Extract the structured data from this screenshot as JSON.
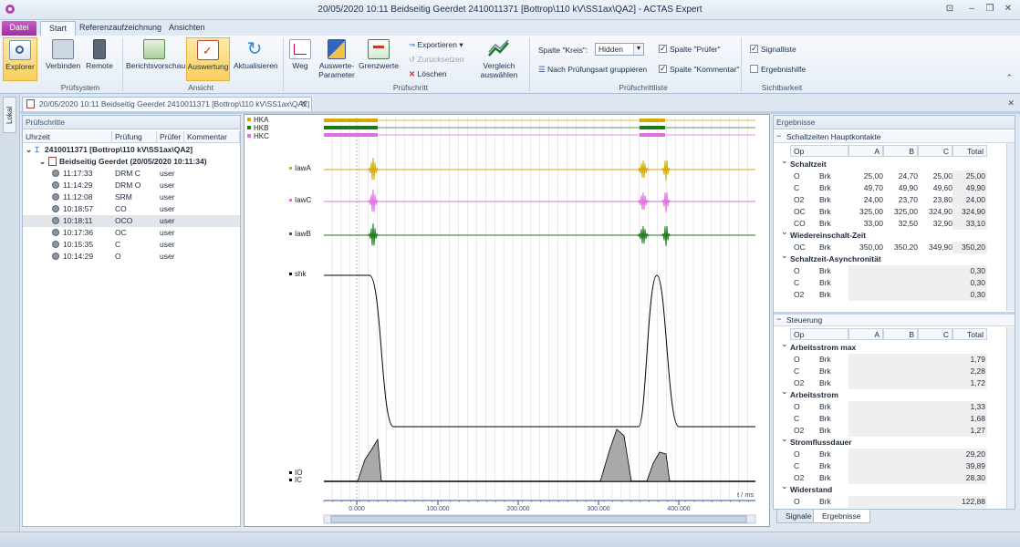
{
  "window": {
    "title": "20/05/2020 10:11 Beidseitig Geerdet 2410011371 [Bottrop\\110 kV\\SS1ax\\QA2] - ACTAS Expert"
  },
  "tabs": {
    "file": "Datei",
    "start": "Start",
    "reference": "Referenzaufzeichnung",
    "views": "Ansichten"
  },
  "ribbon": {
    "explorer": "Explorer",
    "connect": "Verbinden",
    "remote": "Remote",
    "group_system": "Prüfsystem",
    "report_preview": "Berichtsvorschau",
    "evaluation": "Auswertung",
    "refresh": "Aktualisieren",
    "group_view": "Ansicht",
    "path": "Weg",
    "eval_params_1": "Auswerte-",
    "eval_params_2": "Parameter",
    "limits": "Grenzwerte",
    "export": "Exportieren",
    "reset": "Zurücksetzen",
    "delete": "Löschen",
    "compare_1": "Vergleich",
    "compare_2": "auswählen",
    "group_step": "Prüfschritt",
    "column_circle_label": "Spalte \"Kreis\":",
    "column_circle_value": "Hidden",
    "group_by_type": "Nach Prüfungsart gruppieren",
    "col_tester": "Spalte \"Prüfer\"",
    "col_comment": "Spalte \"Kommentar\"",
    "group_list": "Prüfschrittliste",
    "signal_list": "Signalliste",
    "result_help": "Ergebnishilfe",
    "group_visibility": "Sichtbarkeit"
  },
  "sidebar": {
    "local_tab": "Lokal"
  },
  "document_tab": {
    "label": "20/05/2020 10:11 Beidseitig Geerdet 2410011371 [Bottrop\\110 kV\\SS1ax\\QA2]"
  },
  "steps_panel": {
    "title": "Prüfschritte",
    "columns": [
      "Uhrzeit",
      "Prüfung",
      "Prüfer",
      "Kommentar"
    ],
    "root": "2410011371 [Bottrop\\110 kV\\SS1ax\\QA2]",
    "session": "Beidseitig Geerdet (20/05/2020 10:11:34)",
    "rows": [
      {
        "time": "11:17:33",
        "test": "DRM C",
        "tester": "user"
      },
      {
        "time": "11:14:29",
        "test": "DRM O",
        "tester": "user"
      },
      {
        "time": "11:12:08",
        "test": "SRM",
        "tester": "user"
      },
      {
        "time": "10:18:57",
        "test": "CO",
        "tester": "user"
      },
      {
        "time": "10:18:11",
        "test": "OCO",
        "tester": "user"
      },
      {
        "time": "10:17:36",
        "test": "OC",
        "tester": "user"
      },
      {
        "time": "10:15:35",
        "test": "C",
        "tester": "user"
      },
      {
        "time": "10:14:29",
        "test": "O",
        "tester": "user"
      }
    ]
  },
  "chart": {
    "legend": [
      "HKA",
      "HKB",
      "HKC"
    ],
    "channels": [
      "IawA",
      "IawC",
      "IawB",
      "shk",
      "IO",
      "IC"
    ],
    "axis_unit": "t / ms",
    "ticks": [
      "0.000",
      "100.000",
      "200.000",
      "300.000",
      "400.000"
    ],
    "colors": {
      "hka": "#d4aa00",
      "hkb": "#1a7a1a",
      "hkc": "#e070e0"
    }
  },
  "results": {
    "title": "Ergebnisse",
    "section1": "Schaltzeiten Hauptkontakte",
    "section2": "Steuerung",
    "columns": [
      "Op",
      "A",
      "B",
      "C",
      "Total"
    ],
    "groups1": [
      {
        "name": "Schaltzeit",
        "rows": [
          {
            "op": "O",
            "type": "Brk",
            "a": "25,00",
            "b": "24,70",
            "c": "25,00",
            "total": "25,00"
          },
          {
            "op": "C",
            "type": "Brk",
            "a": "49,70",
            "b": "49,90",
            "c": "49,60",
            "total": "49,90"
          },
          {
            "op": "O2",
            "type": "Brk",
            "a": "24,00",
            "b": "23,70",
            "c": "23,80",
            "total": "24,00"
          },
          {
            "op": "OC",
            "type": "Brk",
            "a": "325,00",
            "b": "325,00",
            "c": "324,90",
            "total": "324,90"
          },
          {
            "op": "CO",
            "type": "Brk",
            "a": "33,00",
            "b": "32,50",
            "c": "32,90",
            "total": "33,10"
          }
        ]
      },
      {
        "name": "Wiedereinschalt-Zeit",
        "rows": [
          {
            "op": "OC",
            "type": "Brk",
            "a": "350,00",
            "b": "350,20",
            "c": "349,90",
            "total": "350,20"
          }
        ]
      },
      {
        "name": "Schaltzeit-Asynchronität",
        "rows": [
          {
            "op": "O",
            "type": "Brk",
            "total": "0,30"
          },
          {
            "op": "C",
            "type": "Brk",
            "total": "0,30"
          },
          {
            "op": "O2",
            "type": "Brk",
            "total": "0,30"
          }
        ]
      }
    ],
    "groups2": [
      {
        "name": "Arbeitsstrom max",
        "rows": [
          {
            "op": "O",
            "type": "Brk",
            "total": "1,79"
          },
          {
            "op": "C",
            "type": "Brk",
            "total": "2,28"
          },
          {
            "op": "O2",
            "type": "Brk",
            "total": "1,72"
          }
        ]
      },
      {
        "name": "Arbeitsstrom",
        "rows": [
          {
            "op": "O",
            "type": "Brk",
            "total": "1,33"
          },
          {
            "op": "C",
            "type": "Brk",
            "total": "1,68"
          },
          {
            "op": "O2",
            "type": "Brk",
            "total": "1,27"
          }
        ]
      },
      {
        "name": "Stromflussdauer",
        "rows": [
          {
            "op": "O",
            "type": "Brk",
            "total": "29,20"
          },
          {
            "op": "C",
            "type": "Brk",
            "total": "39,89"
          },
          {
            "op": "O2",
            "type": "Brk",
            "total": "28,30"
          }
        ]
      },
      {
        "name": "Widerstand",
        "rows": [
          {
            "op": "O",
            "type": "Brk",
            "total": "122,88"
          }
        ]
      }
    ],
    "bottom_tabs": [
      "Signale",
      "Ergebnisse"
    ]
  }
}
